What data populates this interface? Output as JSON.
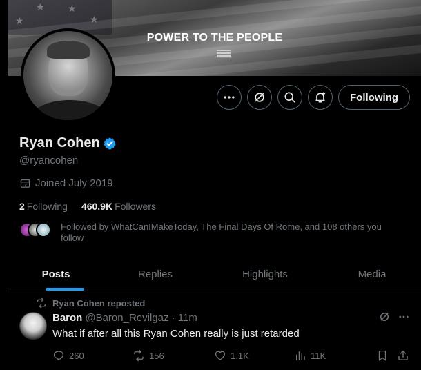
{
  "banner": {
    "text": "POWER TO THE PEOPLE"
  },
  "actions": {
    "following_label": "Following"
  },
  "profile": {
    "name": "Ryan Cohen",
    "handle": "@ryancohen",
    "joined": "Joined July 2019",
    "following_count": "2",
    "following_label": "Following",
    "followers_count": "460.9K",
    "followers_label": "Followers",
    "followed_by": "Followed by WhatCanIMakeToday, The Final Days Of Rome, and 108 others you follow"
  },
  "tabs": [
    {
      "label": "Posts",
      "active": true
    },
    {
      "label": "Replies",
      "active": false
    },
    {
      "label": "Highlights",
      "active": false
    },
    {
      "label": "Media",
      "active": false
    }
  ],
  "post": {
    "repost_label": "Ryan Cohen reposted",
    "author_name": "Baron",
    "author_handle": "@Baron_Revilgaz · 11m",
    "text": "What if after all this Ryan Cohen really is just retarded",
    "replies": "260",
    "reposts": "156",
    "likes": "1.1K",
    "views": "11K"
  },
  "colors": {
    "accent": "#1d9bf0",
    "muted": "#71767b",
    "text": "#e7e9ea",
    "border": "#2f3336"
  }
}
